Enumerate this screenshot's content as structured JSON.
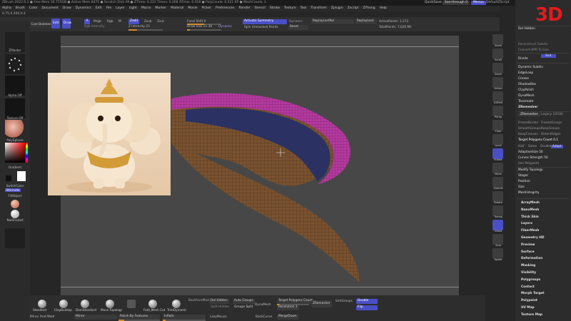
{
  "titlebar": {
    "text": "ZBrush 2022.0.1  ● Free Mem 30.755GB ● Active Mem 8475 ● Scratch Disk 49 ● ZTime▹ 0.223 Timer▹ 0.008 ATime▹ 0.018 ● PolyCount▹ 0.321 KP ● MeshCount▹ 1",
    "quicksave": "QuickSave",
    "seethrough": "See-through 0",
    "menus": "Menus",
    "default_zscript": "DefaultZScript"
  },
  "menubar": [
    "Alpha",
    "Brush",
    "Color",
    "Document",
    "Draw",
    "Dynamics",
    "Edit",
    "File",
    "Layer",
    "Light",
    "Macro",
    "Marker",
    "Material",
    "Movie",
    "Picker",
    "Preferences",
    "Render",
    "Stencil",
    "Stroke",
    "Texture",
    "Tool",
    "Transform",
    "Zplugin",
    "Zscript",
    "ZYhong",
    "Help"
  ],
  "coords": "0.75,0.466,0.4",
  "shelf": {
    "lightbox": "LightBox",
    "live_boolean": "Live Boolean",
    "edit": "Edit",
    "draw": "Draw",
    "a_label": "A",
    "mrgb": "Mrgb",
    "rgb": "Rgb",
    "m": "M",
    "zadd": "Zadd",
    "zsub": "Zsub",
    "zcut": "Zcut",
    "rgb_intensity": "Rgb Intensity",
    "z_intensity": "Z Intensity 25",
    "focal_shift": "Focal Shift 0",
    "draw_size": "Draw Size 21.36",
    "dynamic": "Dynamic",
    "activate_symmetry": "Activate Symmetry",
    "spin_unmasked": "Spin Unmasked Points",
    "reset": "Reset",
    "replicate_last": "ReplayLastRel",
    "replay_last": "ReplayLast",
    "active_points": "ActivePoints: 1,272",
    "total_points": "TotalPoints: 7,026 Mil"
  },
  "left": {
    "zmaster": "ZMaster",
    "alpha_off": "Alpha Off",
    "texture_off": "Texture Off",
    "polysphere": "PolySphere",
    "gradient": "Gradient",
    "switch_color": "SwitchColor",
    "alternate": "Alternate",
    "fill_object": "FillObject",
    "not_shaded": "NotShaded",
    "color_hex": "#ff0000"
  },
  "righttools": [
    "Zoom",
    "Scroll",
    "Zoom",
    "Actual",
    "AAHalf",
    "Persp",
    "Floor",
    "Local",
    "Frame",
    "Move",
    "ZoomD",
    "Rotate",
    "Transp",
    "Ghost",
    "Solo",
    "Xpose"
  ],
  "panel": {
    "logo": "3D",
    "top_items": [
      "Del Hidden",
      "Reconstruct Subdiv",
      "Convert BPR To Geo",
      "Divide",
      "Smt",
      "Dynamic Subdiv",
      "EdgeLoop",
      "Crease",
      "ShadowBox",
      "ClayPolish",
      "DynaMesh",
      "Tessimate",
      "ZRemesher"
    ],
    "zremesher_btn": "ZRemesher",
    "legacy": "Legacy (2018)",
    "freeze_border": "FreezeBorder",
    "freeze_groups": "FreezeGroups",
    "keep_groups": "KeepGroups",
    "smooth_groups": "SmoothGroups",
    "keep_creases": "KeepCreases",
    "detect_edges": "DetectEdges",
    "target_polycount": "Target Polygons Count 0.1",
    "half": "Half",
    "same": "Same",
    "double": "Double",
    "adapt": "Adapt",
    "adaptive_size": "AdaptiveSize 50",
    "curves_strength": "Curves Strength 50",
    "use_polypaint": "Use Polypaint",
    "sub_items": [
      "Modify Topology",
      "Stager",
      "Position",
      "Size",
      "MeshIntegrity"
    ],
    "sections": [
      "ArrayMesh",
      "NanoMesh",
      "Thick Skin",
      "Layers",
      "FiberMesh",
      "Geometry HD",
      "Preview",
      "Surface",
      "Deformation",
      "Masking",
      "Visibility",
      "Polygroups",
      "Contact",
      "Morph Target",
      "Polypaint",
      "UV Map",
      "Texture Map"
    ]
  },
  "bottom": {
    "brushes": [
      "Standard",
      "ClayBuildup",
      "DamStandard",
      "Move Topologi",
      "",
      "Fold_Mesh Cut",
      "TrimDynamic"
    ],
    "backface_mask": "BackfaceMask",
    "del_hidden": "Del Hidden",
    "auto_groups": "Auto Groups",
    "split_hidden": "Split Hidden",
    "groups_split": "Groups Split",
    "dyna_mesh": "DynaMesh",
    "target_poly": "Target Polygons Count",
    "zremesher": "ZRemesher",
    "resolution": "Resolution 1",
    "smt_groups": "SmtGroups",
    "double": "Double",
    "flip": "Flip",
    "mirror_weld": "Mirror And Weld",
    "mirror": "Mirror",
    "polish_features": "Polish By Features",
    "inflate": "Inflate",
    "lazy_mouse": "LazyMouse",
    "back_curve": "BackCurve",
    "merge_down": "MergeDown"
  }
}
